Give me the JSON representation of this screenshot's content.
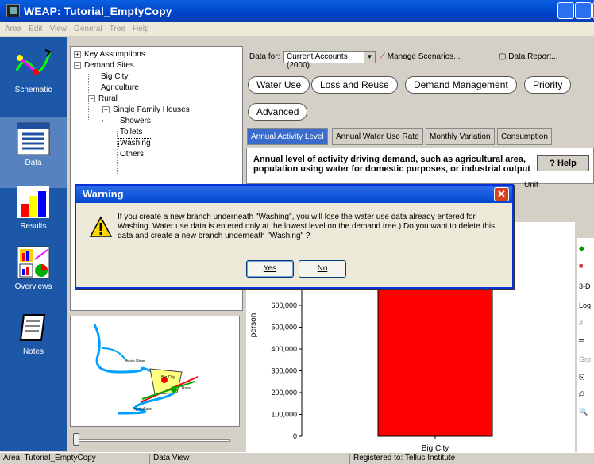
{
  "window": {
    "title": "WEAP: Tutorial_EmptyCopy"
  },
  "menu": [
    "Area",
    "Edit",
    "View",
    "General",
    "Tree",
    "Help"
  ],
  "nav": [
    {
      "label": "Schematic",
      "icon": "schematic-icon"
    },
    {
      "label": "Data",
      "icon": "data-icon"
    },
    {
      "label": "Results",
      "icon": "results-icon"
    },
    {
      "label": "Overviews",
      "icon": "overviews-icon"
    },
    {
      "label": "Notes",
      "icon": "notes-icon"
    }
  ],
  "tree": {
    "key_assumptions": "Key Assumptions",
    "demand_sites": "Demand Sites",
    "big_city": "Big City",
    "agriculture": "Agriculture",
    "rural": "Rural",
    "single_family": "Single Family Houses",
    "showers": "Showers",
    "toilets": "Toilets",
    "washing": "Washing",
    "others": "Others"
  },
  "toolbar": {
    "data_for_label": "Data for:",
    "data_for_value": "Current Accounts (2000)",
    "manage_scenarios": "Manage Scenarios...",
    "data_report": "Data Report..."
  },
  "categories": [
    "Water Use",
    "Loss and Reuse",
    "Demand Management",
    "Priority",
    "Advanced"
  ],
  "tabs": [
    "Annual Activity Level",
    "Annual Water Use Rate",
    "Monthly Variation",
    "Consumption"
  ],
  "description": "Annual level of activity driving demand, such as agricultural area, population using water for domestic purposes, or industrial output",
  "help_label": "Help",
  "unit_label": "Unit",
  "side_tools": [
    "3-D",
    "Log",
    "Grp"
  ],
  "chart_data": {
    "type": "bar",
    "categories": [
      "Big City"
    ],
    "values": [
      700000
    ],
    "ylabel": "person",
    "ylim": [
      0,
      700000
    ],
    "yticks": [
      "0",
      "100,000",
      "200,000",
      "300,000",
      "400,000",
      "500,000",
      "600,000"
    ],
    "bar_color": "#ff0000"
  },
  "map_labels": [
    "Main River",
    "Big City",
    "Rural",
    "Agriculture"
  ],
  "dialog": {
    "title": "Warning",
    "message": "If you create a new branch underneath \"Washing\", you will lose the water use data already entered for Washing.  Water use data is entered only at the lowest level on the demand tree.)  Do you want to delete this data and create a new branch underneath \"Washing\" ?",
    "yes": "Yes",
    "no": "No"
  },
  "status": {
    "area": "Area: Tutorial_EmptyCopy",
    "view": "Data View",
    "registered": "Registered to: Tellus Institute"
  }
}
